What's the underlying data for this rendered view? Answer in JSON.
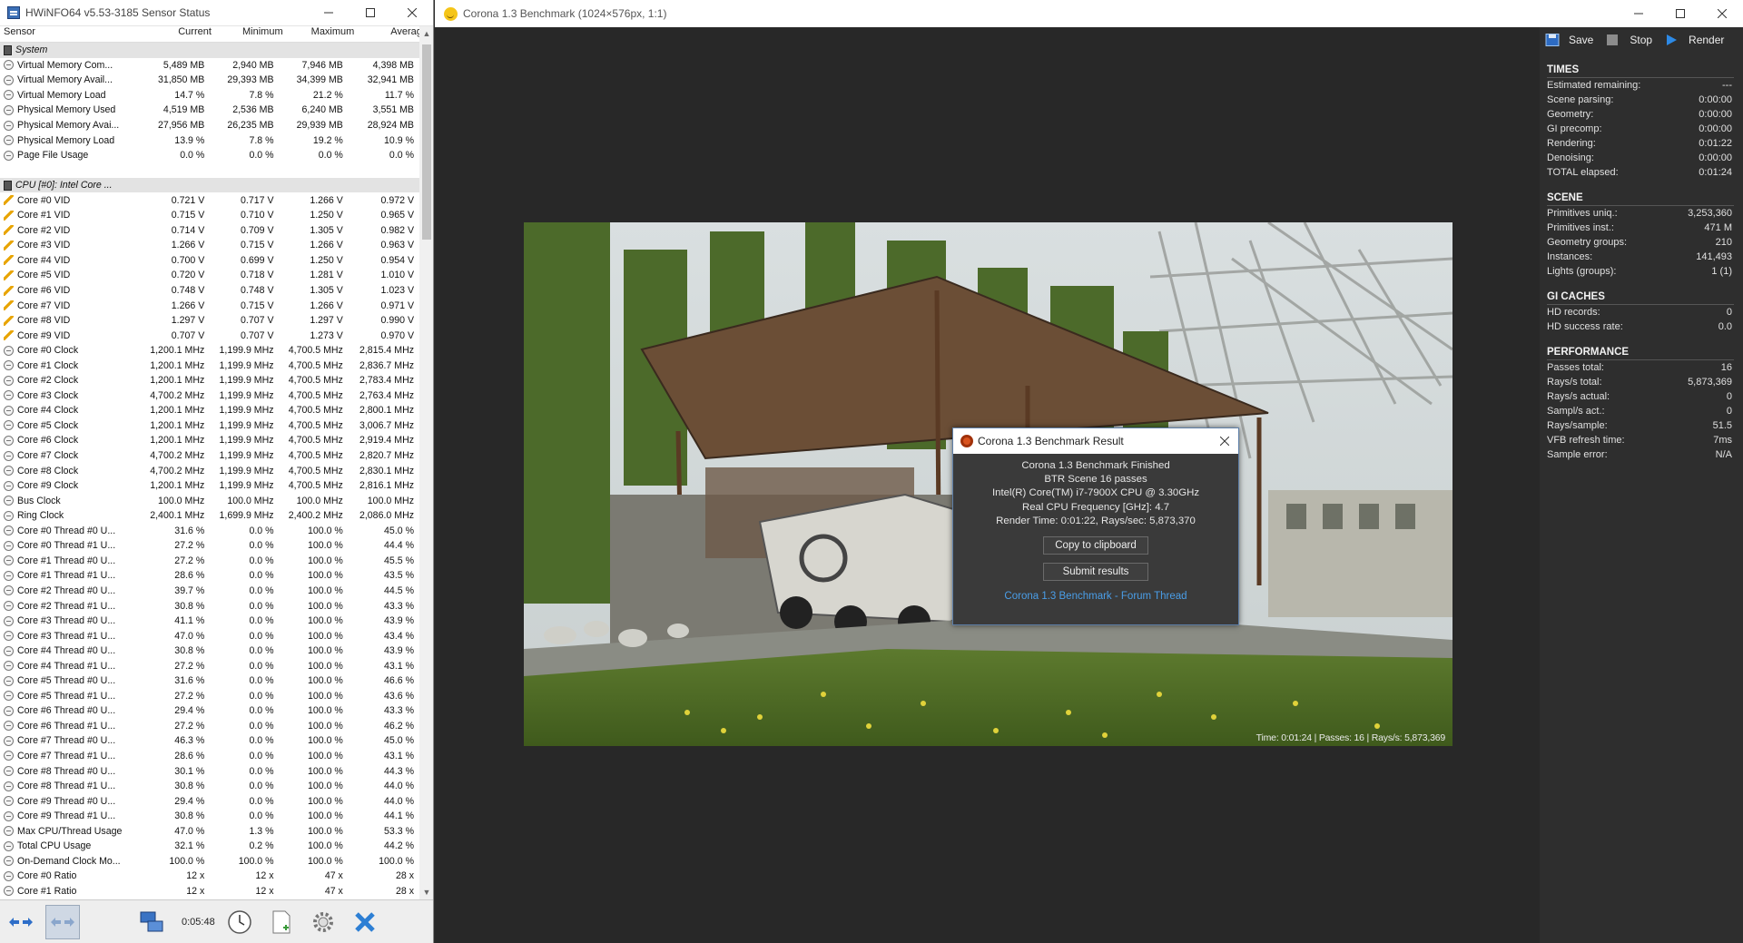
{
  "hwinfo": {
    "title": "HWiNFO64 v5.53-3185 Sensor Status",
    "columns": [
      "Sensor",
      "Current",
      "Minimum",
      "Maximum",
      "Average"
    ],
    "rows": [
      {
        "k": "grp",
        "name": "System",
        "cur": "",
        "min": "",
        "max": "",
        "avg": ""
      },
      {
        "k": "circ",
        "name": "Virtual Memory Com...",
        "cur": "5,489 MB",
        "min": "2,940 MB",
        "max": "7,946 MB",
        "avg": "4,398 MB"
      },
      {
        "k": "circ",
        "name": "Virtual Memory Avail...",
        "cur": "31,850 MB",
        "min": "29,393 MB",
        "max": "34,399 MB",
        "avg": "32,941 MB"
      },
      {
        "k": "circ",
        "name": "Virtual Memory Load",
        "cur": "14.7 %",
        "min": "7.8 %",
        "max": "21.2 %",
        "avg": "11.7 %"
      },
      {
        "k": "circ",
        "name": "Physical Memory Used",
        "cur": "4,519 MB",
        "min": "2,536 MB",
        "max": "6,240 MB",
        "avg": "3,551 MB"
      },
      {
        "k": "circ",
        "name": "Physical Memory Avai...",
        "cur": "27,956 MB",
        "min": "26,235 MB",
        "max": "29,939 MB",
        "avg": "28,924 MB"
      },
      {
        "k": "circ",
        "name": "Physical Memory Load",
        "cur": "13.9 %",
        "min": "7.8 %",
        "max": "19.2 %",
        "avg": "10.9 %"
      },
      {
        "k": "circ",
        "name": "Page File Usage",
        "cur": "0.0 %",
        "min": "0.0 %",
        "max": "0.0 %",
        "avg": "0.0 %"
      },
      {
        "k": "blank",
        "name": "",
        "cur": "",
        "min": "",
        "max": "",
        "avg": ""
      },
      {
        "k": "grp",
        "name": "CPU [#0]: Intel Core ...",
        "cur": "",
        "min": "",
        "max": "",
        "avg": ""
      },
      {
        "k": "bolt",
        "name": "Core #0 VID",
        "cur": "0.721 V",
        "min": "0.717 V",
        "max": "1.266 V",
        "avg": "0.972 V"
      },
      {
        "k": "bolt",
        "name": "Core #1 VID",
        "cur": "0.715 V",
        "min": "0.710 V",
        "max": "1.250 V",
        "avg": "0.965 V"
      },
      {
        "k": "bolt",
        "name": "Core #2 VID",
        "cur": "0.714 V",
        "min": "0.709 V",
        "max": "1.305 V",
        "avg": "0.982 V"
      },
      {
        "k": "bolt",
        "name": "Core #3 VID",
        "cur": "1.266 V",
        "min": "0.715 V",
        "max": "1.266 V",
        "avg": "0.963 V"
      },
      {
        "k": "bolt",
        "name": "Core #4 VID",
        "cur": "0.700 V",
        "min": "0.699 V",
        "max": "1.250 V",
        "avg": "0.954 V"
      },
      {
        "k": "bolt",
        "name": "Core #5 VID",
        "cur": "0.720 V",
        "min": "0.718 V",
        "max": "1.281 V",
        "avg": "1.010 V"
      },
      {
        "k": "bolt",
        "name": "Core #6 VID",
        "cur": "0.748 V",
        "min": "0.748 V",
        "max": "1.305 V",
        "avg": "1.023 V"
      },
      {
        "k": "bolt",
        "name": "Core #7 VID",
        "cur": "1.266 V",
        "min": "0.715 V",
        "max": "1.266 V",
        "avg": "0.971 V"
      },
      {
        "k": "bolt",
        "name": "Core #8 VID",
        "cur": "1.297 V",
        "min": "0.707 V",
        "max": "1.297 V",
        "avg": "0.990 V"
      },
      {
        "k": "bolt",
        "name": "Core #9 VID",
        "cur": "0.707 V",
        "min": "0.707 V",
        "max": "1.273 V",
        "avg": "0.970 V"
      },
      {
        "k": "circ",
        "name": "Core #0 Clock",
        "cur": "1,200.1 MHz",
        "min": "1,199.9 MHz",
        "max": "4,700.5 MHz",
        "avg": "2,815.4 MHz"
      },
      {
        "k": "circ",
        "name": "Core #1 Clock",
        "cur": "1,200.1 MHz",
        "min": "1,199.9 MHz",
        "max": "4,700.5 MHz",
        "avg": "2,836.7 MHz"
      },
      {
        "k": "circ",
        "name": "Core #2 Clock",
        "cur": "1,200.1 MHz",
        "min": "1,199.9 MHz",
        "max": "4,700.5 MHz",
        "avg": "2,783.4 MHz"
      },
      {
        "k": "circ",
        "name": "Core #3 Clock",
        "cur": "4,700.2 MHz",
        "min": "1,199.9 MHz",
        "max": "4,700.5 MHz",
        "avg": "2,763.4 MHz"
      },
      {
        "k": "circ",
        "name": "Core #4 Clock",
        "cur": "1,200.1 MHz",
        "min": "1,199.9 MHz",
        "max": "4,700.5 MHz",
        "avg": "2,800.1 MHz"
      },
      {
        "k": "circ",
        "name": "Core #5 Clock",
        "cur": "1,200.1 MHz",
        "min": "1,199.9 MHz",
        "max": "4,700.5 MHz",
        "avg": "3,006.7 MHz"
      },
      {
        "k": "circ",
        "name": "Core #6 Clock",
        "cur": "1,200.1 MHz",
        "min": "1,199.9 MHz",
        "max": "4,700.5 MHz",
        "avg": "2,919.4 MHz"
      },
      {
        "k": "circ",
        "name": "Core #7 Clock",
        "cur": "4,700.2 MHz",
        "min": "1,199.9 MHz",
        "max": "4,700.5 MHz",
        "avg": "2,820.7 MHz"
      },
      {
        "k": "circ",
        "name": "Core #8 Clock",
        "cur": "4,700.2 MHz",
        "min": "1,199.9 MHz",
        "max": "4,700.5 MHz",
        "avg": "2,830.1 MHz"
      },
      {
        "k": "circ",
        "name": "Core #9 Clock",
        "cur": "1,200.1 MHz",
        "min": "1,199.9 MHz",
        "max": "4,700.5 MHz",
        "avg": "2,816.1 MHz"
      },
      {
        "k": "circ",
        "name": "Bus Clock",
        "cur": "100.0 MHz",
        "min": "100.0 MHz",
        "max": "100.0 MHz",
        "avg": "100.0 MHz"
      },
      {
        "k": "circ",
        "name": "Ring Clock",
        "cur": "2,400.1 MHz",
        "min": "1,699.9 MHz",
        "max": "2,400.2 MHz",
        "avg": "2,086.0 MHz"
      },
      {
        "k": "circ",
        "name": "Core #0 Thread #0 U...",
        "cur": "31.6 %",
        "min": "0.0 %",
        "max": "100.0 %",
        "avg": "45.0 %"
      },
      {
        "k": "circ",
        "name": "Core #0 Thread #1 U...",
        "cur": "27.2 %",
        "min": "0.0 %",
        "max": "100.0 %",
        "avg": "44.4 %"
      },
      {
        "k": "circ",
        "name": "Core #1 Thread #0 U...",
        "cur": "27.2 %",
        "min": "0.0 %",
        "max": "100.0 %",
        "avg": "45.5 %"
      },
      {
        "k": "circ",
        "name": "Core #1 Thread #1 U...",
        "cur": "28.6 %",
        "min": "0.0 %",
        "max": "100.0 %",
        "avg": "43.5 %"
      },
      {
        "k": "circ",
        "name": "Core #2 Thread #0 U...",
        "cur": "39.7 %",
        "min": "0.0 %",
        "max": "100.0 %",
        "avg": "44.5 %"
      },
      {
        "k": "circ",
        "name": "Core #2 Thread #1 U...",
        "cur": "30.8 %",
        "min": "0.0 %",
        "max": "100.0 %",
        "avg": "43.3 %"
      },
      {
        "k": "circ",
        "name": "Core #3 Thread #0 U...",
        "cur": "41.1 %",
        "min": "0.0 %",
        "max": "100.0 %",
        "avg": "43.9 %"
      },
      {
        "k": "circ",
        "name": "Core #3 Thread #1 U...",
        "cur": "47.0 %",
        "min": "0.0 %",
        "max": "100.0 %",
        "avg": "43.4 %"
      },
      {
        "k": "circ",
        "name": "Core #4 Thread #0 U...",
        "cur": "30.8 %",
        "min": "0.0 %",
        "max": "100.0 %",
        "avg": "43.9 %"
      },
      {
        "k": "circ",
        "name": "Core #4 Thread #1 U...",
        "cur": "27.2 %",
        "min": "0.0 %",
        "max": "100.0 %",
        "avg": "43.1 %"
      },
      {
        "k": "circ",
        "name": "Core #5 Thread #0 U...",
        "cur": "31.6 %",
        "min": "0.0 %",
        "max": "100.0 %",
        "avg": "46.6 %"
      },
      {
        "k": "circ",
        "name": "Core #5 Thread #1 U...",
        "cur": "27.2 %",
        "min": "0.0 %",
        "max": "100.0 %",
        "avg": "43.6 %"
      },
      {
        "k": "circ",
        "name": "Core #6 Thread #0 U...",
        "cur": "29.4 %",
        "min": "0.0 %",
        "max": "100.0 %",
        "avg": "43.3 %"
      },
      {
        "k": "circ",
        "name": "Core #6 Thread #1 U...",
        "cur": "27.2 %",
        "min": "0.0 %",
        "max": "100.0 %",
        "avg": "46.2 %"
      },
      {
        "k": "circ",
        "name": "Core #7 Thread #0 U...",
        "cur": "46.3 %",
        "min": "0.0 %",
        "max": "100.0 %",
        "avg": "45.0 %"
      },
      {
        "k": "circ",
        "name": "Core #7 Thread #1 U...",
        "cur": "28.6 %",
        "min": "0.0 %",
        "max": "100.0 %",
        "avg": "43.1 %"
      },
      {
        "k": "circ",
        "name": "Core #8 Thread #0 U...",
        "cur": "30.1 %",
        "min": "0.0 %",
        "max": "100.0 %",
        "avg": "44.3 %"
      },
      {
        "k": "circ",
        "name": "Core #8 Thread #1 U...",
        "cur": "30.8 %",
        "min": "0.0 %",
        "max": "100.0 %",
        "avg": "44.0 %"
      },
      {
        "k": "circ",
        "name": "Core #9 Thread #0 U...",
        "cur": "29.4 %",
        "min": "0.0 %",
        "max": "100.0 %",
        "avg": "44.0 %"
      },
      {
        "k": "circ",
        "name": "Core #9 Thread #1 U...",
        "cur": "30.8 %",
        "min": "0.0 %",
        "max": "100.0 %",
        "avg": "44.1 %"
      },
      {
        "k": "circ",
        "name": "Max CPU/Thread Usage",
        "cur": "47.0 %",
        "min": "1.3 %",
        "max": "100.0 %",
        "avg": "53.3 %"
      },
      {
        "k": "circ",
        "name": "Total CPU Usage",
        "cur": "32.1 %",
        "min": "0.2 %",
        "max": "100.0 %",
        "avg": "44.2 %"
      },
      {
        "k": "circ",
        "name": "On-Demand Clock Mo...",
        "cur": "100.0 %",
        "min": "100.0 %",
        "max": "100.0 %",
        "avg": "100.0 %"
      },
      {
        "k": "circ",
        "name": "Core #0 Ratio",
        "cur": "12 x",
        "min": "12 x",
        "max": "47 x",
        "avg": "28 x"
      },
      {
        "k": "circ",
        "name": "Core #1 Ratio",
        "cur": "12 x",
        "min": "12 x",
        "max": "47 x",
        "avg": "28 x"
      }
    ],
    "timer": "0:05:48"
  },
  "corona": {
    "title": "Corona 1.3 Benchmark (1024×576px, 1:1)",
    "toolbar": {
      "save": "Save",
      "stop": "Stop",
      "render": "Render"
    },
    "status": "Time: 0:01:24 | Passes: 16 | Rays/s: 5,873,369",
    "sections": [
      {
        "title": "TIMES",
        "items": [
          {
            "label": "Estimated remaining:",
            "value": "---"
          },
          {
            "label": "Scene parsing:",
            "value": "0:00:00"
          },
          {
            "label": "Geometry:",
            "value": "0:00:00"
          },
          {
            "label": "GI precomp:",
            "value": "0:00:00"
          },
          {
            "label": "Rendering:",
            "value": "0:01:22"
          },
          {
            "label": "Denoising:",
            "value": "0:00:00"
          },
          {
            "label": "TOTAL elapsed:",
            "value": "0:01:24"
          }
        ]
      },
      {
        "title": "SCENE",
        "items": [
          {
            "label": "Primitives uniq.:",
            "value": "3,253,360"
          },
          {
            "label": "Primitives inst.:",
            "value": "471 M"
          },
          {
            "label": "Geometry groups:",
            "value": "210"
          },
          {
            "label": "Instances:",
            "value": "141,493"
          },
          {
            "label": "Lights (groups):",
            "value": "1 (1)"
          }
        ]
      },
      {
        "title": "GI CACHES",
        "items": [
          {
            "label": "HD records:",
            "value": "0"
          },
          {
            "label": "HD success rate:",
            "value": "0.0"
          }
        ]
      },
      {
        "title": "PERFORMANCE",
        "items": [
          {
            "label": "Passes total:",
            "value": "16"
          },
          {
            "label": "Rays/s total:",
            "value": "5,873,369"
          },
          {
            "label": "Rays/s actual:",
            "value": "0"
          },
          {
            "label": "Sampl/s act.:",
            "value": "0"
          },
          {
            "label": "Rays/sample:",
            "value": "51.5"
          },
          {
            "label": "VFB refresh time:",
            "value": "7ms"
          },
          {
            "label": "Sample error:",
            "value": "N/A"
          }
        ]
      }
    ],
    "dialog": {
      "title": "Corona 1.3 Benchmark Result",
      "lines": [
        "Corona 1.3 Benchmark Finished",
        "BTR Scene 16 passes",
        "Intel(R) Core(TM) i7-7900X CPU @ 3.30GHz",
        "Real CPU Frequency [GHz]: 4.7",
        "Render Time: 0:01:22, Rays/sec: 5,873,370"
      ],
      "copy_button": "Copy to clipboard",
      "submit_button": "Submit results",
      "link": "Corona 1.3 Benchmark - Forum Thread"
    }
  },
  "colors": {
    "accent_link": "#4a9ee8",
    "render_button": "#2d8ae6"
  }
}
